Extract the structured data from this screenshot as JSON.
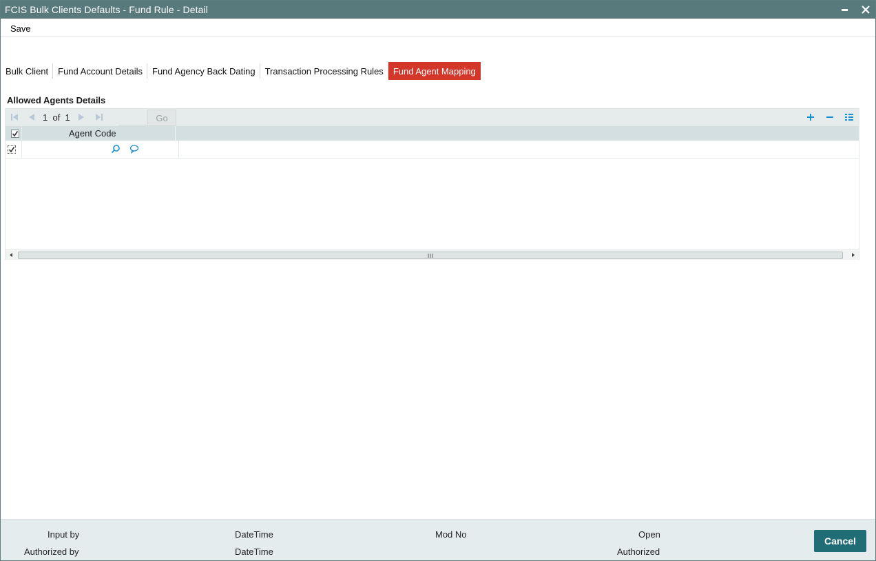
{
  "window": {
    "title": "FCIS Bulk Clients Defaults - Fund Rule - Detail"
  },
  "menu": {
    "save_label": "Save"
  },
  "tabs": [
    {
      "label": "Bulk Client",
      "active": false
    },
    {
      "label": "Fund Account Details",
      "active": false
    },
    {
      "label": "Fund Agency Back Dating",
      "active": false
    },
    {
      "label": "Transaction Processing Rules",
      "active": false
    },
    {
      "label": "Fund Agent Mapping",
      "active": true
    }
  ],
  "section": {
    "title": "Allowed Agents Details"
  },
  "grid": {
    "pager": {
      "current": "1",
      "of_label": "of",
      "total": "1",
      "go_label": "Go"
    },
    "columns": [
      "Agent Code"
    ],
    "header_checked": true,
    "rows": [
      {
        "checked": true,
        "agent_code": ""
      }
    ],
    "actions": [
      "add-icon",
      "remove-icon",
      "list-icon"
    ]
  },
  "footer": {
    "input_by": "Input by",
    "authorized_by": "Authorized by",
    "datetime_1": "DateTime",
    "datetime_2": "DateTime",
    "mod_no": "Mod No",
    "open": "Open",
    "authorized": "Authorized",
    "cancel_label": "Cancel"
  },
  "colors": {
    "titlebar": "#587a7d",
    "active_tab": "#d2372a",
    "cancel_button": "#216d75",
    "accent_icon": "#1a8fd0"
  }
}
